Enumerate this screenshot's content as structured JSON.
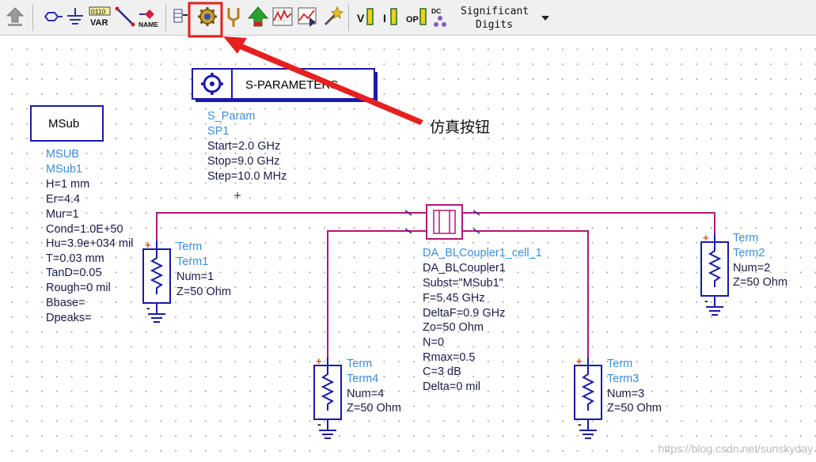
{
  "toolbar": {
    "var_label": "VAR",
    "var_digits": "0110",
    "name_label": "NAME",
    "v_label": "V",
    "i_label": "I",
    "op_label": "OP",
    "dc_label": "DC",
    "significant_digits_line1": "Significant",
    "significant_digits_line2": "Digits"
  },
  "annotation": {
    "label": "仿真按钮",
    "color": "#e52020"
  },
  "sparam": {
    "box_title": "S-PARAMETERS",
    "type": "S_Param",
    "name": "SP1",
    "start": "Start=2.0 GHz",
    "stop": "Stop=9.0 GHz",
    "step": "Step=10.0 MHz"
  },
  "msub": {
    "box_title": "MSub",
    "type": "MSUB",
    "name": "MSub1",
    "params": [
      "H=1 mm",
      "Er=4.4",
      "Mur=1",
      "Cond=1.0E+50",
      "Hu=3.9e+034 mil",
      "T=0.03 mm",
      "TanD=0.05",
      "Rough=0 mil",
      "Bbase=",
      "Dpeaks="
    ]
  },
  "coupler": {
    "cell_name": "DA_BLCoupler1_cell_1",
    "instance": "DA_BLCoupler1",
    "params": [
      "Subst=\"MSub1\"",
      "F=5.45 GHz",
      "DeltaF=0.9 GHz",
      "Zo=50 Ohm",
      "N=0",
      "Rmax=0.5",
      "C=3 dB",
      "Delta=0 mil"
    ]
  },
  "terms": [
    {
      "type": "Term",
      "name": "Term1",
      "num": "Num=1",
      "z": "Z=50 Ohm"
    },
    {
      "type": "Term",
      "name": "Term2",
      "num": "Num=2",
      "z": "Z=50 Ohm"
    },
    {
      "type": "Term",
      "name": "Term3",
      "num": "Num=3",
      "z": "Z=50 Ohm"
    },
    {
      "type": "Term",
      "name": "Term4",
      "num": "Num=4",
      "z": "Z=50 Ohm"
    }
  ],
  "watermark": "https://blog.csdn.net/sunskyday",
  "colors": {
    "wire": "#b0187a",
    "component": "#1a1aa8",
    "label_blue": "#3a8fdc",
    "label_dark": "#1a1a4a"
  }
}
